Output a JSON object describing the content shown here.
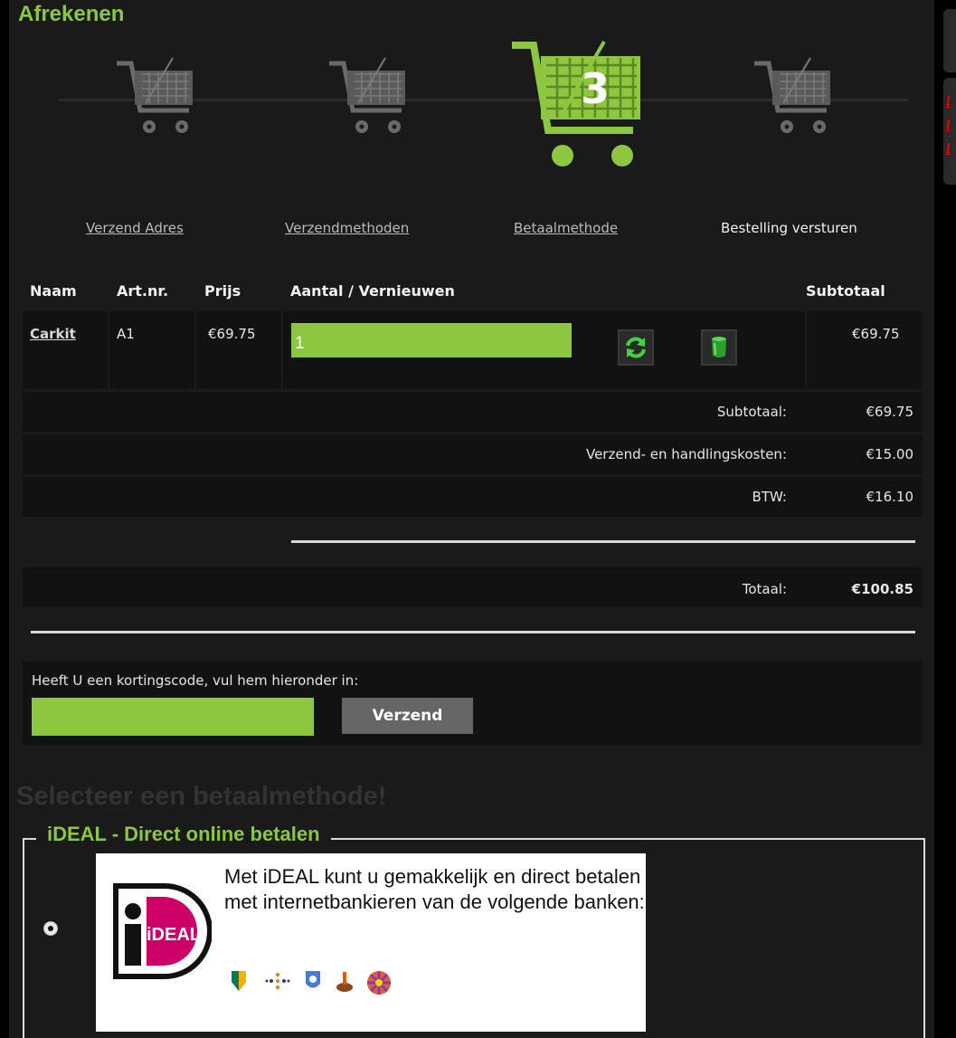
{
  "page": {
    "title": "Afrekenen"
  },
  "steps": {
    "current_step_number": "3",
    "items": [
      {
        "label": "Verzend Adres",
        "state": "done"
      },
      {
        "label": "Verzendmethoden",
        "state": "done"
      },
      {
        "label": "Betaalmethode",
        "state": "current"
      },
      {
        "label": "Bestelling versturen",
        "state": "todo"
      }
    ]
  },
  "cart_table": {
    "headers": {
      "name": "Naam",
      "sku": "Art.nr.",
      "price": "Prijs",
      "qty": "Aantal / Vernieuwen",
      "subtotal": "Subtotaal"
    },
    "rows": [
      {
        "name": "Carkit",
        "sku": "A1",
        "price": "€69.75",
        "qty": "1",
        "subtotal": "€69.75",
        "update_icon": "refresh-icon",
        "delete_icon": "trash-icon"
      }
    ]
  },
  "summary": {
    "subtotal_label": "Subtotaal:",
    "subtotal_value": "€69.75",
    "shipping_label": "Verzend- en handlingskosten:",
    "shipping_value": "€15.00",
    "vat_label": "BTW:",
    "vat_value": "€16.10",
    "total_label": "Totaal:",
    "total_value": "€100.85"
  },
  "discount": {
    "label": "Heeft U een kortingscode, vul hem hieronder in:",
    "input_value": "",
    "button_label": "Verzend"
  },
  "payment": {
    "heading": "Selecteer een betaalmethode!",
    "methods": [
      {
        "title": "iDEAL - Direct online betalen",
        "logo_text": "iDEAL",
        "description": "Met iDEAL kunt u gemakkelijk en direct betalen met internetbankieren van de volgende banken:",
        "selected": true
      }
    ]
  },
  "colors": {
    "accent": "#8dc63f",
    "background": "#1a1a1a",
    "row_bg": "#121212",
    "heading_dim": "#333333"
  }
}
